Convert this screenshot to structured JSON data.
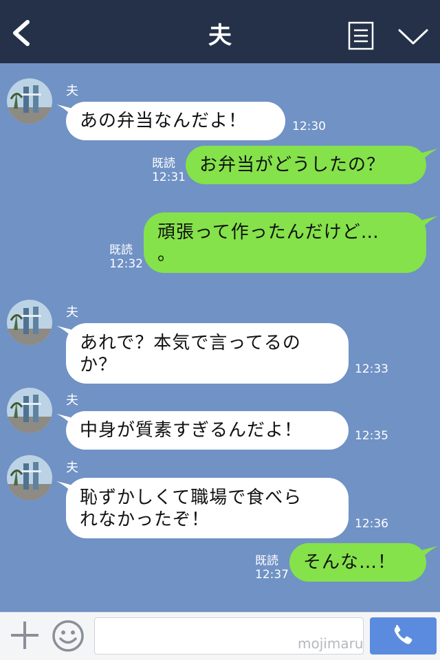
{
  "header": {
    "title": "夫"
  },
  "messages": [
    {
      "from": "夫",
      "text": "あの弁当なんだよ！",
      "time": "12:30"
    },
    {
      "read": "既読",
      "text": "お弁当がどうしたの？",
      "time": "12:31"
    },
    {
      "read": "既読",
      "line1": "頑張って作ったんだけど…",
      "line2": "。",
      "time": "12:32"
    },
    {
      "from": "夫",
      "line1": "あれで？本気で言ってるの",
      "line2": "か？",
      "time": "12:33"
    },
    {
      "from": "夫",
      "text": "中身が質素すぎるんだよ！",
      "time": "12:35"
    },
    {
      "from": "夫",
      "line1": "恥ずかしくて職場で食べら",
      "line2": "れなかったぞ！",
      "time": "12:36"
    },
    {
      "read": "既読",
      "text": "そんな…！",
      "time": "12:37"
    }
  ],
  "footer": {
    "input_value": "",
    "watermark": "mojimaru"
  },
  "colors": {
    "header_bg": "#253149",
    "chat_bg": "#7092c5",
    "incoming_bubble": "#ffffff",
    "outgoing_bubble": "#85e24a",
    "send_button": "#5b8bdf"
  },
  "icons": {
    "back": "chevron-left-icon",
    "menu": "menu-icon",
    "collapse": "chevron-down-icon",
    "add": "plus-icon",
    "sticker": "smile-icon",
    "call": "phone-icon"
  }
}
